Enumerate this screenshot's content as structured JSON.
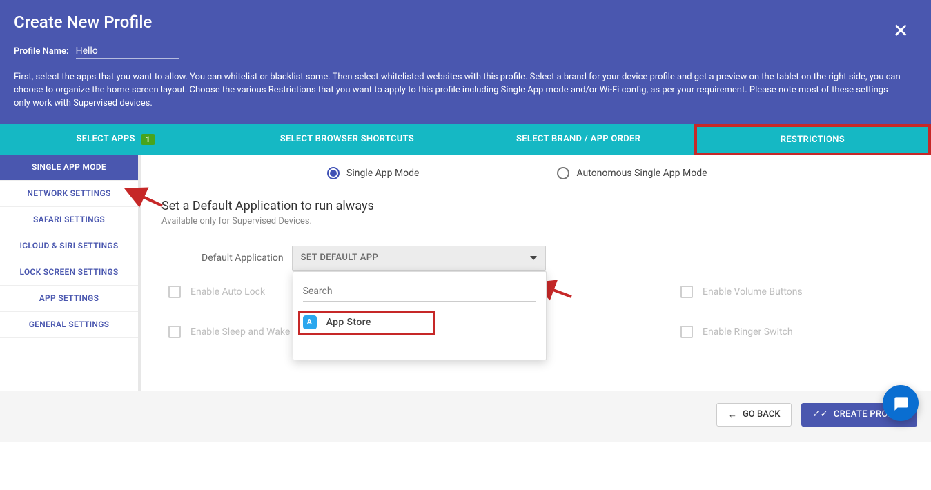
{
  "header": {
    "title": "Create New Profile",
    "profile_name_label": "Profile Name:",
    "profile_name_value": "Hello",
    "description": "First, select the apps that you want to allow. You can whitelist or blacklist some. Then select whitelisted websites with this profile. Select a brand for your device profile and get a preview on the tablet on the right side, you can choose to organize the home screen layout. Choose the various Restrictions that you want to apply to this profile including Single App mode and/or Wi-Fi config, as per your requirement. Please note most of these settings only work with Supervised devices."
  },
  "tabs": {
    "select_apps": "SELECT APPS",
    "select_apps_badge": "1",
    "browser_shortcuts": "SELECT BROWSER SHORTCUTS",
    "brand_order": "SELECT BRAND / APP ORDER",
    "restrictions": "RESTRICTIONS"
  },
  "sidebar": {
    "items": [
      "SINGLE APP MODE",
      "NETWORK SETTINGS",
      "SAFARI SETTINGS",
      "ICLOUD & SIRI SETTINGS",
      "LOCK SCREEN SETTINGS",
      "APP SETTINGS",
      "GENERAL SETTINGS"
    ]
  },
  "main": {
    "radio_single": "Single App Mode",
    "radio_auto": "Autonomous Single App Mode",
    "section_title": "Set a Default Application to run always",
    "section_sub": "Available only for Supervised Devices.",
    "default_app_label": "Default Application",
    "select_placeholder": "SET DEFAULT APP",
    "search_placeholder": "Search",
    "dropdown_option": "App Store",
    "cb_auto_lock": "Enable Auto Lock",
    "cb_volume": "Enable Volume Buttons",
    "cb_sleep_wake": "Enable Sleep and Wake",
    "cb_ringer": "Enable Ringer Switch"
  },
  "footer": {
    "go_back": "GO BACK",
    "create": "CREATE PROFILE"
  }
}
